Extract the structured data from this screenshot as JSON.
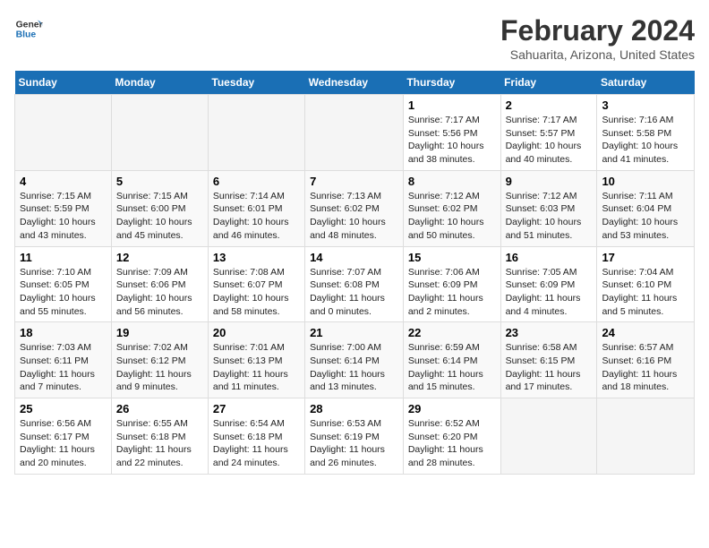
{
  "header": {
    "logo_line1": "General",
    "logo_line2": "Blue",
    "title": "February 2024",
    "subtitle": "Sahuarita, Arizona, United States"
  },
  "days_of_week": [
    "Sunday",
    "Monday",
    "Tuesday",
    "Wednesday",
    "Thursday",
    "Friday",
    "Saturday"
  ],
  "weeks": [
    [
      {
        "day": "",
        "info": ""
      },
      {
        "day": "",
        "info": ""
      },
      {
        "day": "",
        "info": ""
      },
      {
        "day": "",
        "info": ""
      },
      {
        "day": "1",
        "info": "Sunrise: 7:17 AM\nSunset: 5:56 PM\nDaylight: 10 hours\nand 38 minutes."
      },
      {
        "day": "2",
        "info": "Sunrise: 7:17 AM\nSunset: 5:57 PM\nDaylight: 10 hours\nand 40 minutes."
      },
      {
        "day": "3",
        "info": "Sunrise: 7:16 AM\nSunset: 5:58 PM\nDaylight: 10 hours\nand 41 minutes."
      }
    ],
    [
      {
        "day": "4",
        "info": "Sunrise: 7:15 AM\nSunset: 5:59 PM\nDaylight: 10 hours\nand 43 minutes."
      },
      {
        "day": "5",
        "info": "Sunrise: 7:15 AM\nSunset: 6:00 PM\nDaylight: 10 hours\nand 45 minutes."
      },
      {
        "day": "6",
        "info": "Sunrise: 7:14 AM\nSunset: 6:01 PM\nDaylight: 10 hours\nand 46 minutes."
      },
      {
        "day": "7",
        "info": "Sunrise: 7:13 AM\nSunset: 6:02 PM\nDaylight: 10 hours\nand 48 minutes."
      },
      {
        "day": "8",
        "info": "Sunrise: 7:12 AM\nSunset: 6:02 PM\nDaylight: 10 hours\nand 50 minutes."
      },
      {
        "day": "9",
        "info": "Sunrise: 7:12 AM\nSunset: 6:03 PM\nDaylight: 10 hours\nand 51 minutes."
      },
      {
        "day": "10",
        "info": "Sunrise: 7:11 AM\nSunset: 6:04 PM\nDaylight: 10 hours\nand 53 minutes."
      }
    ],
    [
      {
        "day": "11",
        "info": "Sunrise: 7:10 AM\nSunset: 6:05 PM\nDaylight: 10 hours\nand 55 minutes."
      },
      {
        "day": "12",
        "info": "Sunrise: 7:09 AM\nSunset: 6:06 PM\nDaylight: 10 hours\nand 56 minutes."
      },
      {
        "day": "13",
        "info": "Sunrise: 7:08 AM\nSunset: 6:07 PM\nDaylight: 10 hours\nand 58 minutes."
      },
      {
        "day": "14",
        "info": "Sunrise: 7:07 AM\nSunset: 6:08 PM\nDaylight: 11 hours\nand 0 minutes."
      },
      {
        "day": "15",
        "info": "Sunrise: 7:06 AM\nSunset: 6:09 PM\nDaylight: 11 hours\nand 2 minutes."
      },
      {
        "day": "16",
        "info": "Sunrise: 7:05 AM\nSunset: 6:09 PM\nDaylight: 11 hours\nand 4 minutes."
      },
      {
        "day": "17",
        "info": "Sunrise: 7:04 AM\nSunset: 6:10 PM\nDaylight: 11 hours\nand 5 minutes."
      }
    ],
    [
      {
        "day": "18",
        "info": "Sunrise: 7:03 AM\nSunset: 6:11 PM\nDaylight: 11 hours\nand 7 minutes."
      },
      {
        "day": "19",
        "info": "Sunrise: 7:02 AM\nSunset: 6:12 PM\nDaylight: 11 hours\nand 9 minutes."
      },
      {
        "day": "20",
        "info": "Sunrise: 7:01 AM\nSunset: 6:13 PM\nDaylight: 11 hours\nand 11 minutes."
      },
      {
        "day": "21",
        "info": "Sunrise: 7:00 AM\nSunset: 6:14 PM\nDaylight: 11 hours\nand 13 minutes."
      },
      {
        "day": "22",
        "info": "Sunrise: 6:59 AM\nSunset: 6:14 PM\nDaylight: 11 hours\nand 15 minutes."
      },
      {
        "day": "23",
        "info": "Sunrise: 6:58 AM\nSunset: 6:15 PM\nDaylight: 11 hours\nand 17 minutes."
      },
      {
        "day": "24",
        "info": "Sunrise: 6:57 AM\nSunset: 6:16 PM\nDaylight: 11 hours\nand 18 minutes."
      }
    ],
    [
      {
        "day": "25",
        "info": "Sunrise: 6:56 AM\nSunset: 6:17 PM\nDaylight: 11 hours\nand 20 minutes."
      },
      {
        "day": "26",
        "info": "Sunrise: 6:55 AM\nSunset: 6:18 PM\nDaylight: 11 hours\nand 22 minutes."
      },
      {
        "day": "27",
        "info": "Sunrise: 6:54 AM\nSunset: 6:18 PM\nDaylight: 11 hours\nand 24 minutes."
      },
      {
        "day": "28",
        "info": "Sunrise: 6:53 AM\nSunset: 6:19 PM\nDaylight: 11 hours\nand 26 minutes."
      },
      {
        "day": "29",
        "info": "Sunrise: 6:52 AM\nSunset: 6:20 PM\nDaylight: 11 hours\nand 28 minutes."
      },
      {
        "day": "",
        "info": ""
      },
      {
        "day": "",
        "info": ""
      }
    ]
  ]
}
